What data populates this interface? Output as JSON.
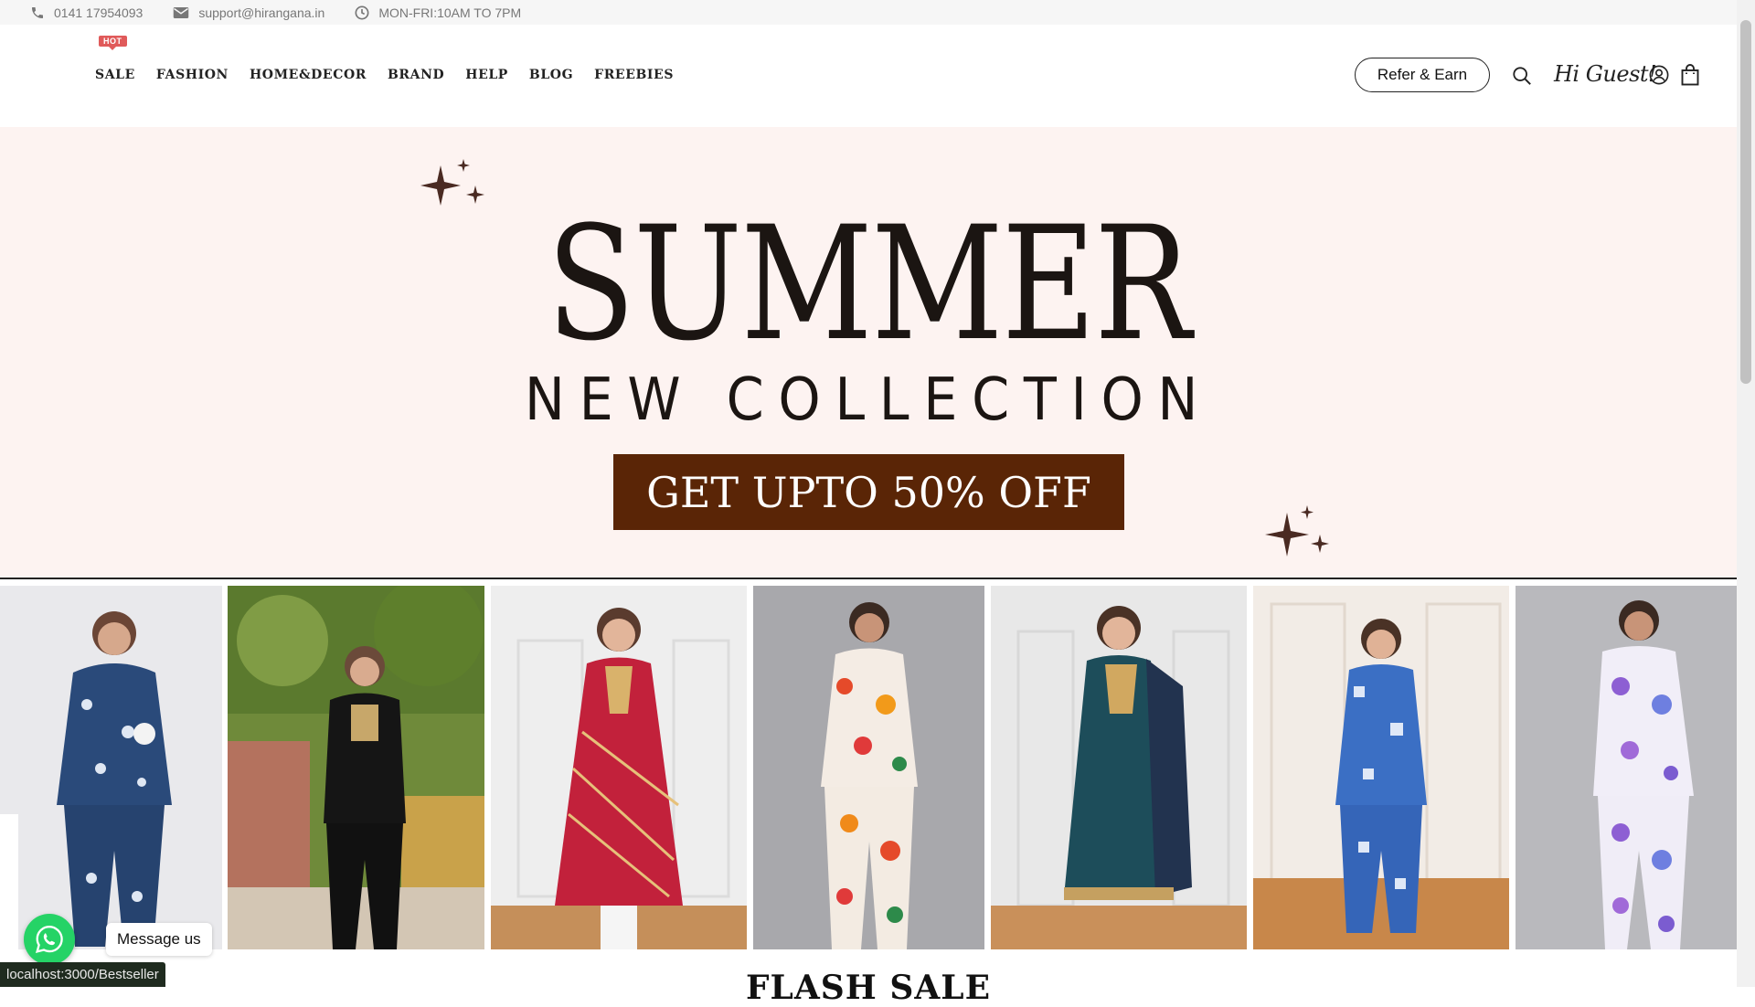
{
  "topbar": {
    "phone": "0141 17954093",
    "email": "support@hirangana.in",
    "hours": "MON-FRI:10AM TO 7PM",
    "icons": [
      "phone-icon",
      "mail-icon",
      "clock-icon"
    ]
  },
  "nav": {
    "badge": "HOT",
    "items": [
      "SALE",
      "FASHION",
      "HOME&DECOR",
      "BRAND",
      "HELP",
      "BLOG",
      "FREEBIES"
    ]
  },
  "header": {
    "refer_label": "Refer & Earn",
    "greeting": "Hi Guest!",
    "icons": [
      "search-icon",
      "user-icon",
      "shopping-bag-icon"
    ]
  },
  "banner": {
    "title": "SUMMER",
    "subtitle": "NEW COLLECTION",
    "offer": "GET UPTO 50% OFF",
    "colors": {
      "background": "#fdf3f1",
      "offer_box": "#5a2506",
      "text": "#1b1512"
    }
  },
  "gallery": {
    "items": [
      {
        "outfit": "Navy floral co-ord set",
        "bg": "#e9e9ec"
      },
      {
        "outfit": "Black embroidered kurta set",
        "bg": "#6f8a3a"
      },
      {
        "outfit": "Red bandhani anarkali",
        "bg": "#eeeeee"
      },
      {
        "outfit": "Floral print co-ord set",
        "bg": "#a8a8ac"
      },
      {
        "outfit": "Teal kurta with dupatta",
        "bg": "#e8e8e8"
      },
      {
        "outfit": "Blue print co-ord set",
        "bg": "#f2ece6"
      },
      {
        "outfit": "Lilac floral co-ord set",
        "bg": "#b9b9bd"
      }
    ]
  },
  "flash_sale": {
    "title": "FLASH SALE"
  },
  "whatsapp": {
    "label": "Message us",
    "color": "#25d366"
  },
  "status_bar": {
    "url": "localhost:3000/Bestseller"
  }
}
